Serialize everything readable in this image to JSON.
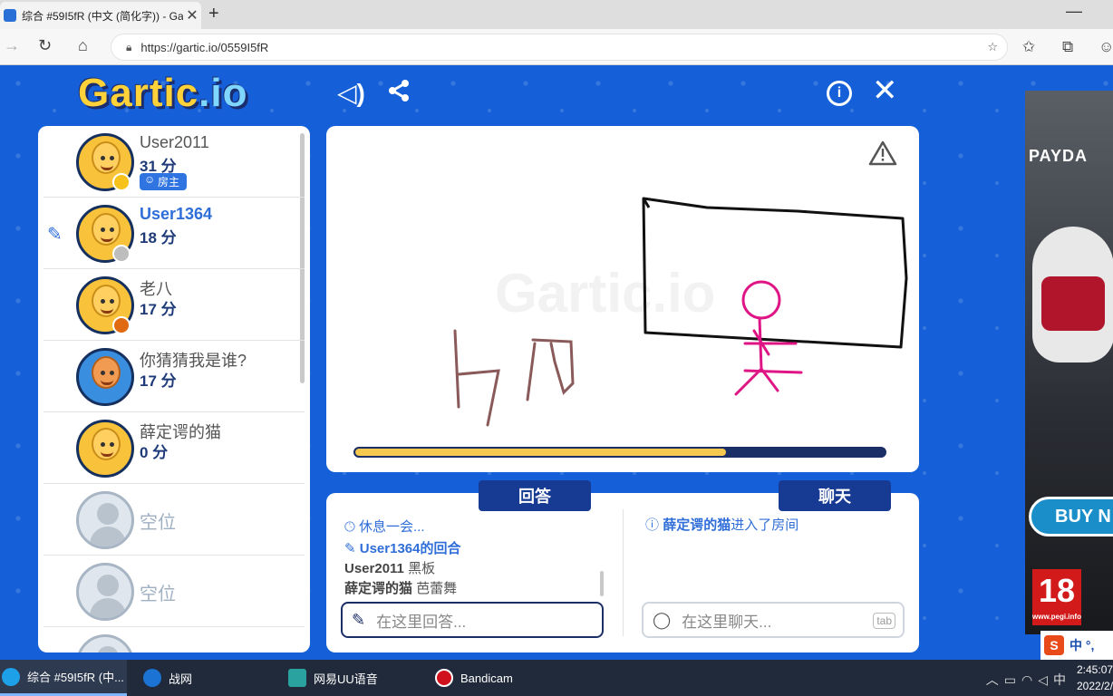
{
  "browser": {
    "tab_title": "综合 #59I5fR (中文 (简化字)) - Ga",
    "url": "https://gartic.io/0559I5fR"
  },
  "game": {
    "logo": "Gartic.io",
    "watermark": "Gartic.io",
    "players": [
      {
        "name": "User2011",
        "score": "31 分",
        "role": "房主",
        "status_color": "#f7c21a",
        "avatar": "smile"
      },
      {
        "name": "User1364",
        "score": "18 分",
        "drawing": true,
        "status_color": "#bdbdbd",
        "avatar": "smile"
      },
      {
        "name": "老八",
        "score": "17 分",
        "status_color": "#e06a12",
        "avatar": "smile"
      },
      {
        "name": "你猜猜我是谁?",
        "score": "17 分",
        "avatar": "blue"
      },
      {
        "name": "薛定谔的猫",
        "score": "0 分",
        "avatar": "smile"
      },
      {
        "empty_label": "空位"
      },
      {
        "empty_label": "空位"
      }
    ],
    "timer_fraction": 0.7,
    "answer": {
      "tab_label": "回答",
      "messages": [
        {
          "icon": "clock-icon",
          "text": "休息一会...",
          "style": "blue"
        },
        {
          "icon": "pencil-icon",
          "text": "User1364的回合",
          "style": "blue"
        },
        {
          "bold": "User2011",
          "text": " 黑板"
        },
        {
          "bold": "薛定谔的猫",
          "text": " 芭蕾舞"
        }
      ],
      "placeholder": "在这里回答..."
    },
    "chat": {
      "tab_label": "聊天",
      "messages": [
        {
          "bold": "薛定谔的猫",
          "text": "进入了房间"
        }
      ],
      "placeholder": "在这里聊天...",
      "tab_key": "tab"
    }
  },
  "ad": {
    "brand": "PAYDA",
    "buy": "BUY N",
    "rating": "18",
    "rating_site": "www.pegi.info"
  },
  "ime": {
    "lang": "中 °,"
  },
  "taskbar": {
    "items": [
      {
        "label": "综合 #59I5fR (中...",
        "color": "#1ea0e8"
      },
      {
        "label": "战网",
        "color": "#1b73d3"
      },
      {
        "label": "网易UU语音",
        "color": "#2aa3a0"
      },
      {
        "label": "Bandicam",
        "color": "#d0101a"
      }
    ],
    "tray_text": "中",
    "time": "2:45:07",
    "date": "2022/2/"
  }
}
